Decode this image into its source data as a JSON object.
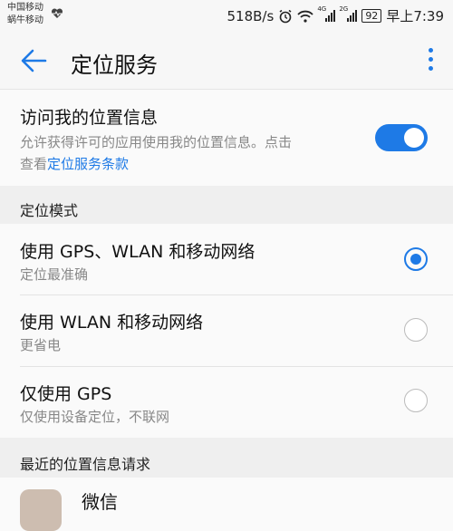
{
  "status_bar": {
    "carrier_1": "中国移动",
    "carrier_2": "蜗牛移动",
    "net_speed": "518B/s",
    "sig1_type": "4G",
    "sig2_type": "2G",
    "battery": "92",
    "time": "早上7:39"
  },
  "app_bar": {
    "title": "定位服务"
  },
  "location_access": {
    "title": "访问我的位置信息",
    "desc_line1": "允许获得许可的应用使用我的位置信息。点击",
    "desc_prefix": "查看",
    "desc_link": "定位服务条款",
    "enabled": true
  },
  "mode_section": {
    "header": "定位模式",
    "options": [
      {
        "title": "使用 GPS、WLAN 和移动网络",
        "subtitle": "定位最准确",
        "selected": true
      },
      {
        "title": "使用 WLAN 和移动网络",
        "subtitle": "更省电",
        "selected": false
      },
      {
        "title": "仅使用 GPS",
        "subtitle": "仅使用设备定位，不联网",
        "selected": false
      }
    ]
  },
  "recent_section": {
    "header": "最近的位置信息请求",
    "apps": [
      {
        "name": "微信"
      }
    ]
  },
  "colors": {
    "accent": "#1e7ae6",
    "background": "#fafafa",
    "section": "#efefef"
  }
}
